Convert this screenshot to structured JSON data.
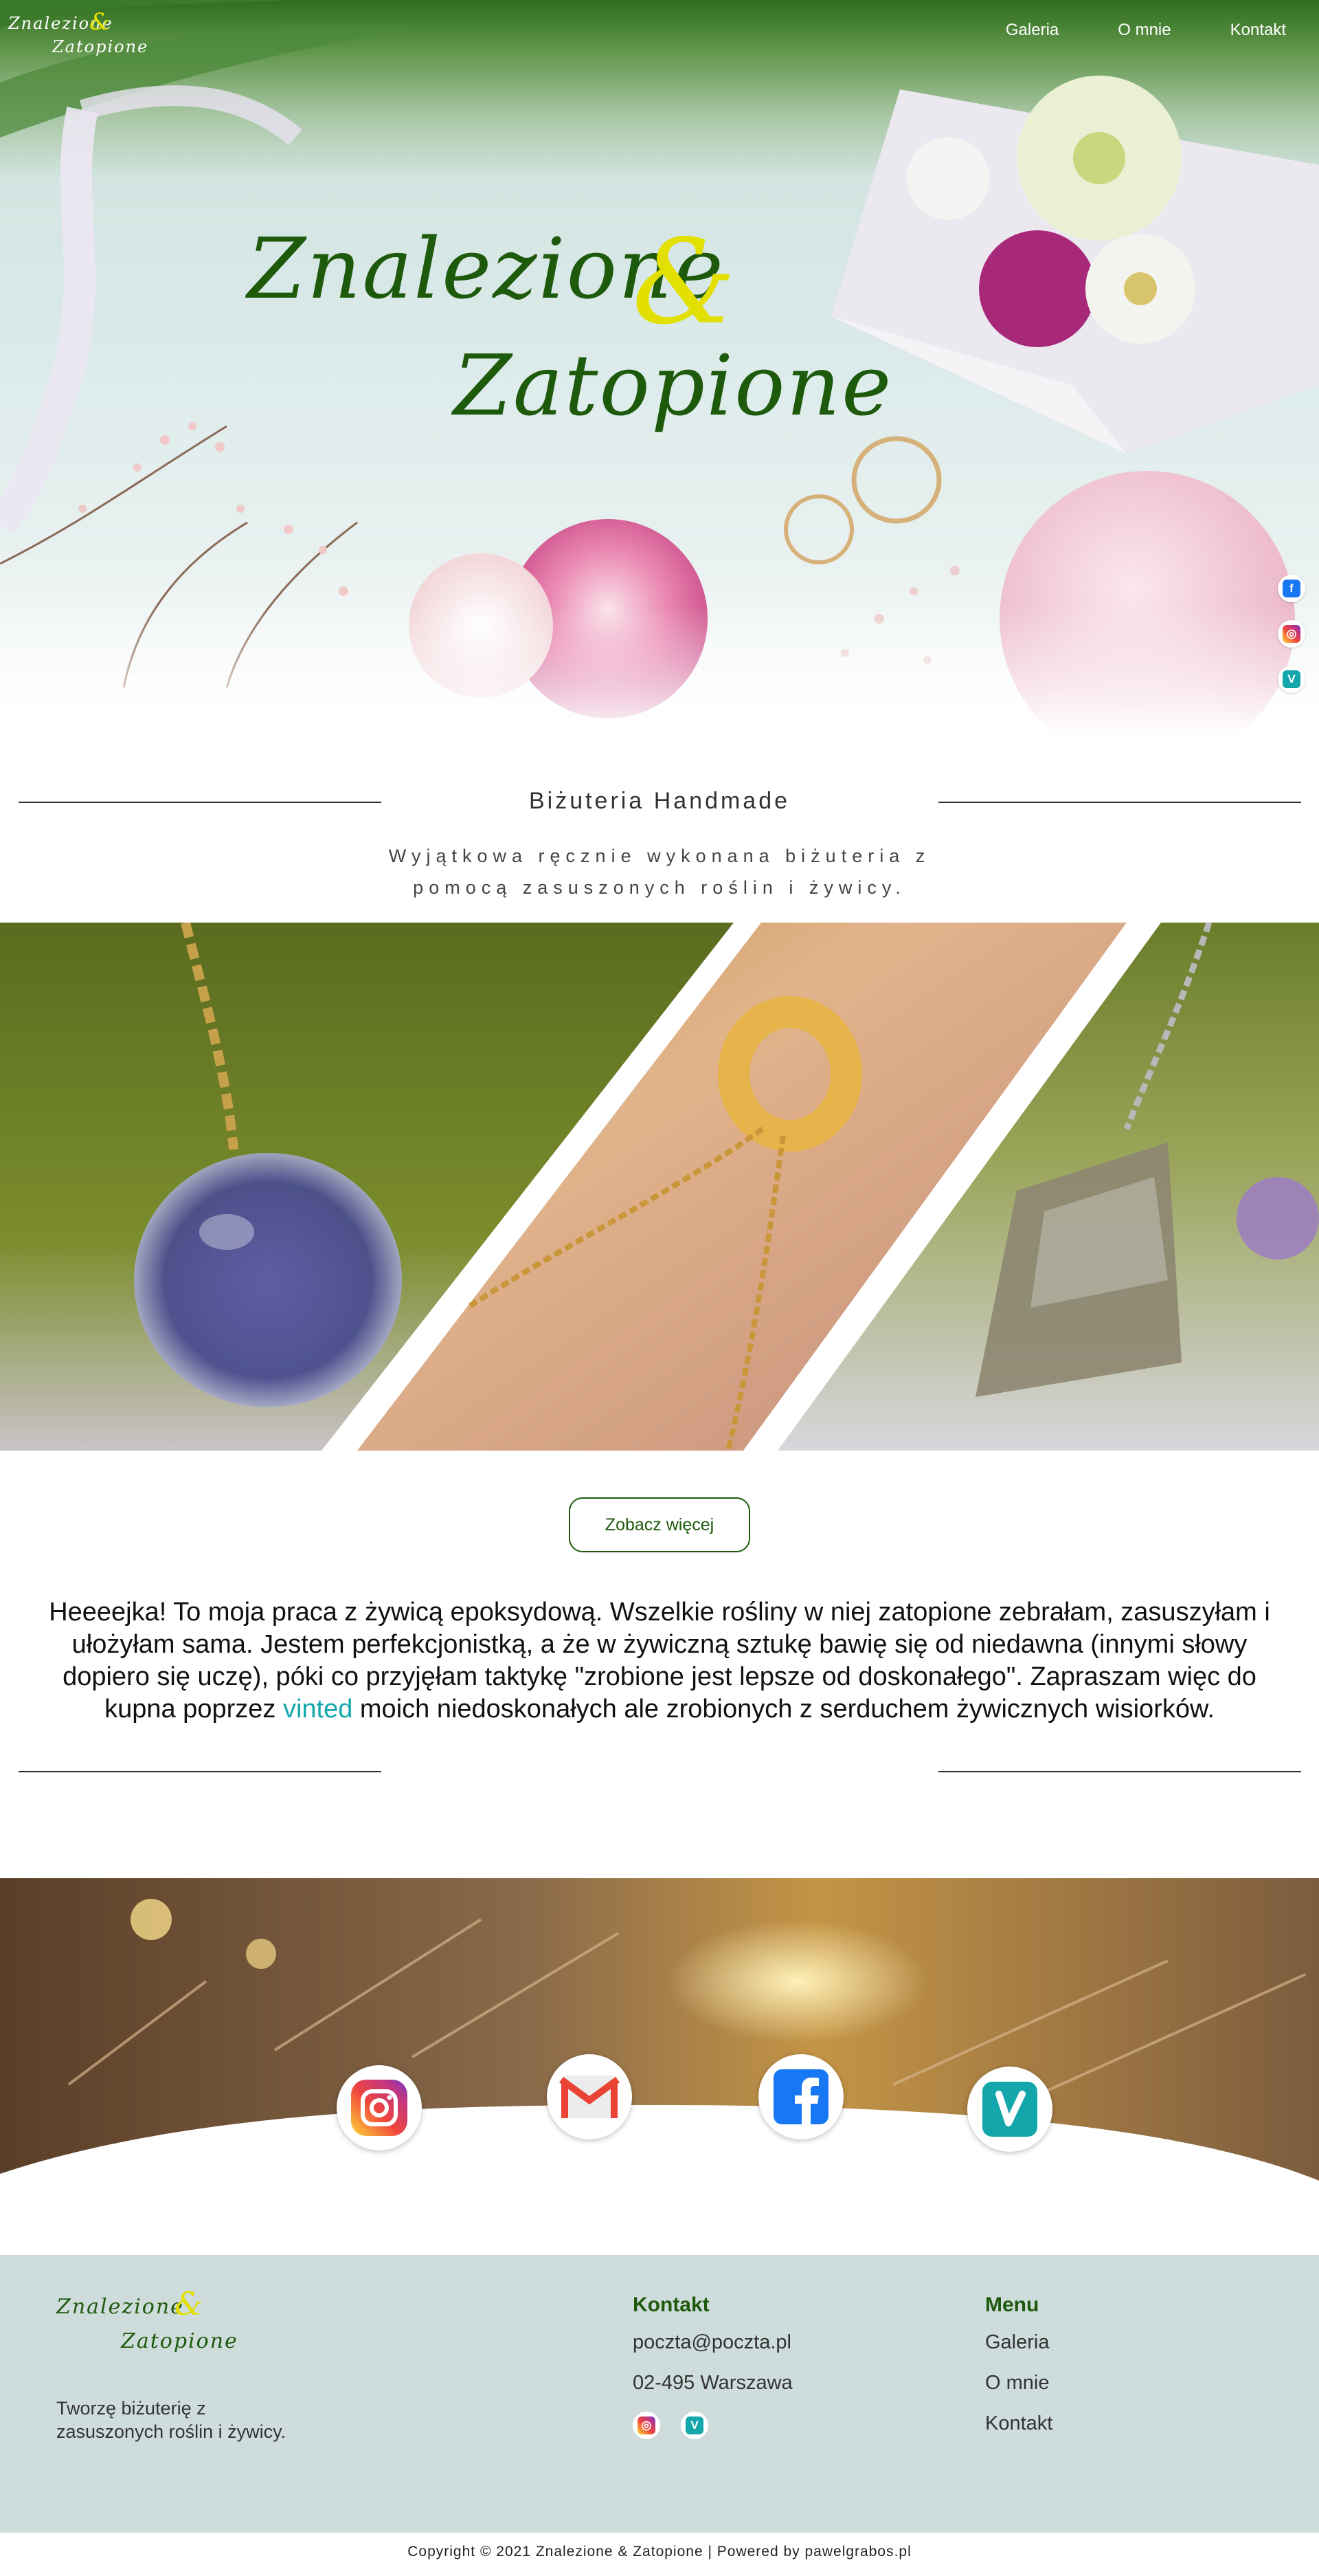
{
  "brand": {
    "word1": "Znalezione",
    "amp": "&",
    "word2": "Zatopione",
    "accent_green": "#1d5a0c",
    "accent_yellow": "#e3df00",
    "accent_teal": "#13a7ab"
  },
  "nav": {
    "items": [
      {
        "label": "Galeria"
      },
      {
        "label": "O mnie"
      },
      {
        "label": "Kontakt"
      }
    ]
  },
  "side_social": [
    {
      "icon": "facebook-icon",
      "glyph": "f"
    },
    {
      "icon": "instagram-icon",
      "glyph": "◎"
    },
    {
      "icon": "vinted-icon",
      "glyph": "V"
    }
  ],
  "intro": {
    "title": "Biżuteria Handmade",
    "subtitle_line1": "Wyjątkowa ręcznie wykonana biżuteria z",
    "subtitle_line2": "pomocą zasuszonych roślin i żywicy."
  },
  "more_button": {
    "label": "Zobacz więcej"
  },
  "about": {
    "before_link": "Heeeejka! To moja praca z żywicą epoksydową. Wszelkie rośliny w niej zatopione zebrałam, zasuszyłam i ułożyłam sama. Jestem perfekcjonistką, a że w żywiczną sztukę bawię się od niedawna (innymi słowy dopiero się uczę), póki co przyjęłam taktykę \"zrobione jest lepsze od doskonałego\". Zapraszam więc do kupna poprzez ",
    "link_text": "vinted",
    "after_link": " moich niedoskonałych ale zrobionych z serduchem żywicznych wisiorków."
  },
  "social_band": [
    {
      "icon": "instagram-icon"
    },
    {
      "icon": "gmail-icon"
    },
    {
      "icon": "facebook-icon"
    },
    {
      "icon": "vinted-icon"
    }
  ],
  "footer": {
    "description": "Tworzę biżuterię z zasuszonych roślin i żywicy.",
    "contact_heading": "Kontakt",
    "email": "poczta@poczta.pl",
    "address": "02-495 Warszawa",
    "menu_heading": "Menu",
    "menu_items": [
      {
        "label": "Galeria"
      },
      {
        "label": "O mnie"
      },
      {
        "label": "Kontakt"
      }
    ],
    "copyright": "Copyright © 2021 Znalezione & Zatopione | Powered by pawelgrabos.pl"
  }
}
